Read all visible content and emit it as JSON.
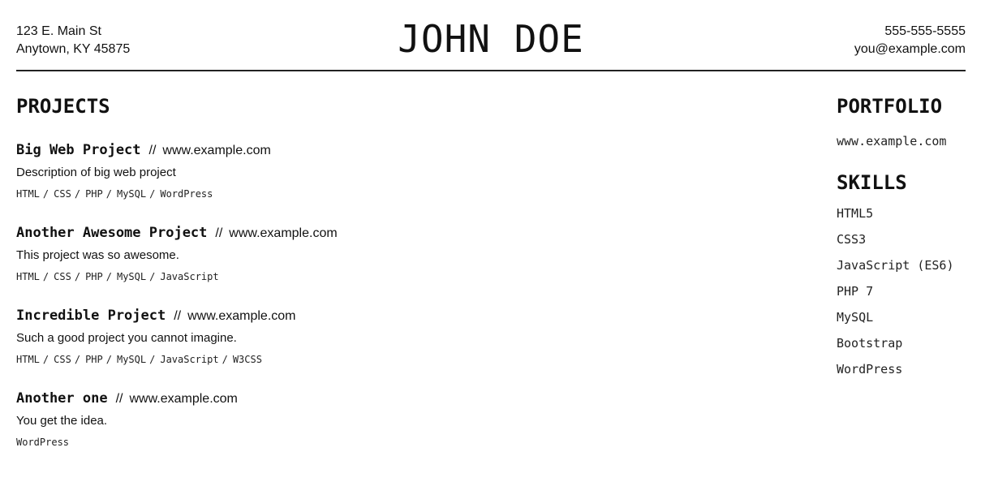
{
  "header": {
    "address_line1": "123 E. Main St",
    "address_line2": "Anytown, KY 45875",
    "name": "JOHN DOE",
    "phone": "555-555-5555",
    "email": "you@example.com"
  },
  "projects": {
    "title": "PROJECTS",
    "separator": "//",
    "items": [
      {
        "title": "Big Web Project",
        "url": "www.example.com",
        "description": "Description of big web project",
        "tags": [
          "HTML",
          "CSS",
          "PHP",
          "MySQL",
          "WordPress"
        ]
      },
      {
        "title": "Another Awesome Project",
        "url": "www.example.com",
        "description": "This project was so awesome.",
        "tags": [
          "HTML",
          "CSS",
          "PHP",
          "MySQL",
          "JavaScript"
        ]
      },
      {
        "title": "Incredible Project",
        "url": "www.example.com",
        "description": "Such a good project you cannot imagine.",
        "tags": [
          "HTML",
          "CSS",
          "PHP",
          "MySQL",
          "JavaScript",
          "W3CSS"
        ]
      },
      {
        "title": "Another one",
        "url": "www.example.com",
        "description": "You get the idea.",
        "tags": [
          "WordPress"
        ]
      }
    ]
  },
  "portfolio": {
    "title": "PORTFOLIO",
    "url": "www.example.com"
  },
  "skills": {
    "title": "SKILLS",
    "items": [
      "HTML5",
      "CSS3",
      "JavaScript (ES6)",
      "PHP 7",
      "MySQL",
      "Bootstrap",
      "WordPress"
    ]
  }
}
